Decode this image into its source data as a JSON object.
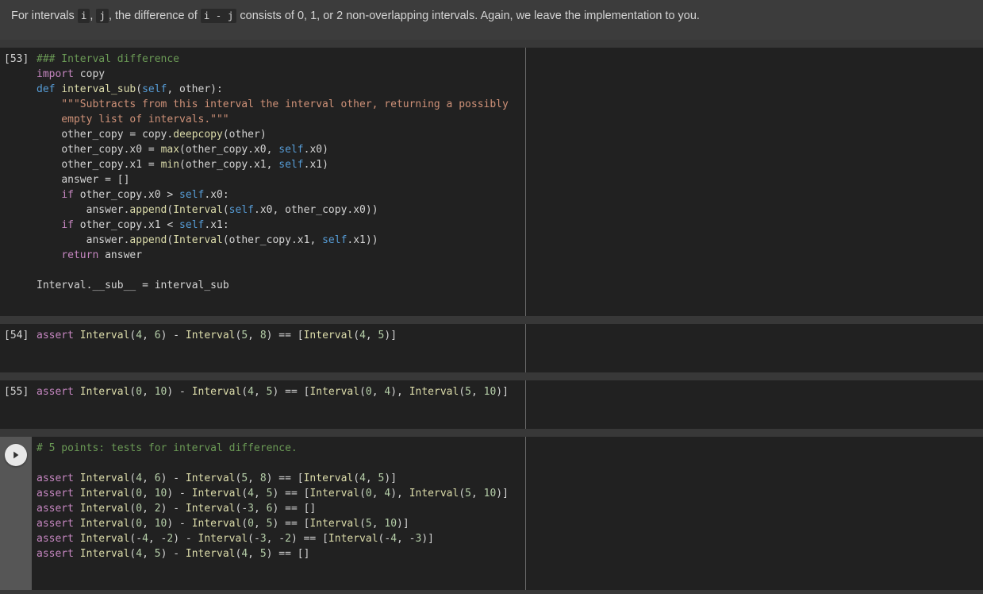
{
  "markdown_cell": {
    "parts": [
      {
        "type": "text",
        "value": "For intervals "
      },
      {
        "type": "code",
        "value": "i"
      },
      {
        "type": "text",
        "value": ", "
      },
      {
        "type": "code",
        "value": "j"
      },
      {
        "type": "text",
        "value": ", the difference of "
      },
      {
        "type": "code",
        "value": "i - j"
      },
      {
        "type": "text",
        "value": " consists of 0, 1, or 2 non-overlapping intervals. Again, we leave the implementation to you."
      }
    ],
    "plain": "For intervals i, j, the difference of i - j consists of 0, 1, or 2 non-overlapping intervals. Again, we leave the implementation to you."
  },
  "cells": [
    {
      "prompt": "[53]",
      "has_run_button": false,
      "source": "### Interval difference\nimport copy\ndef interval_sub(self, other):\n    \"\"\"Subtracts from this interval the interval other, returning a possibly\n    empty list of intervals.\"\"\"\n    other_copy = copy.deepcopy(other)\n    other_copy.x0 = max(other_copy.x0, self.x0)\n    other_copy.x1 = min(other_copy.x1, self.x1)\n    answer = []\n    if other_copy.x0 > self.x0:\n        answer.append(Interval(self.x0, other_copy.x0))\n    if other_copy.x1 < self.x1:\n        answer.append(Interval(other_copy.x1, self.x1))\n    return answer\n\nInterval.__sub__ = interval_sub"
    },
    {
      "prompt": "[54]",
      "has_run_button": false,
      "source": "assert Interval(4, 6) - Interval(5, 8) == [Interval(4, 5)]"
    },
    {
      "prompt": "[55]",
      "has_run_button": false,
      "source": "assert Interval(0, 10) - Interval(4, 5) == [Interval(0, 4), Interval(5, 10)]"
    },
    {
      "prompt": "",
      "has_run_button": true,
      "run_button_label": "Run cell",
      "source": "# 5 points: tests for interval difference.\n\nassert Interval(4, 6) - Interval(5, 8) == [Interval(4, 5)]\nassert Interval(0, 10) - Interval(4, 5) == [Interval(0, 4), Interval(5, 10)]\nassert Interval(0, 2) - Interval(-3, 6) == []\nassert Interval(0, 10) - Interval(0, 5) == [Interval(5, 10)]\nassert Interval(-4, -2) - Interval(-3, -2) == [Interval(-4, -3)]\nassert Interval(4, 5) - Interval(4, 5) == []"
    }
  ],
  "colors": {
    "page_background": "#383838",
    "markdown_background": "#3c3c3c",
    "code_background": "#212121",
    "gutter_active": "#565656",
    "divider": "#6a6a6a",
    "text": "#d4d4d4",
    "comment": "#6a9955",
    "keyword": "#c586c0",
    "keyword_decl": "#569cd6",
    "function": "#dcdcaa",
    "string": "#ce9178",
    "number": "#b5cea8",
    "self": "#569cd6"
  }
}
